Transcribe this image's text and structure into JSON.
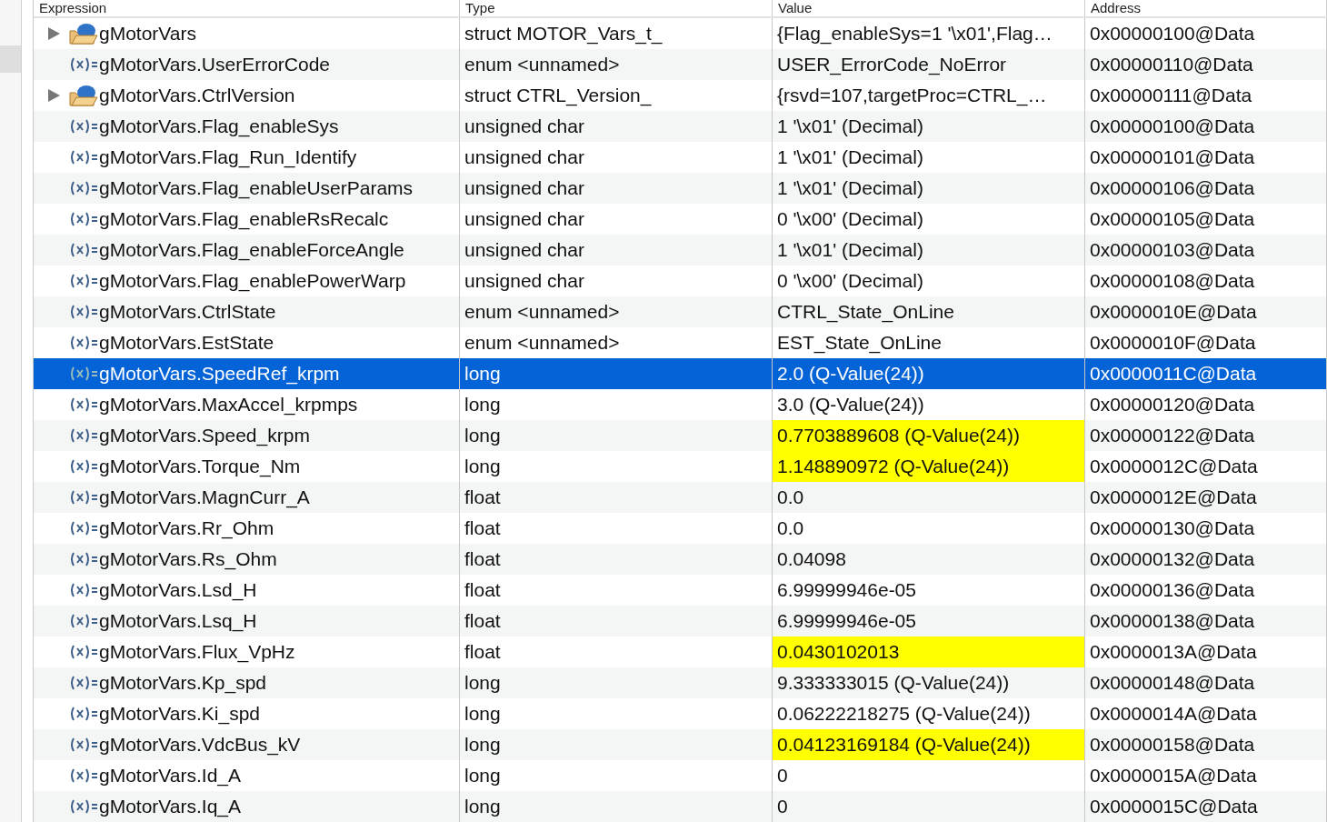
{
  "columns": [
    "Expression",
    "Type",
    "Value",
    "Address"
  ],
  "rows": [
    {
      "kind": "struct",
      "expanded": false,
      "selected": false,
      "changed": false,
      "expression": "gMotorVars",
      "type": "struct MOTOR_Vars_t_",
      "value": "{Flag_enableSys=1 '\\x01',Flag…",
      "address": "0x00000100@Data"
    },
    {
      "kind": "variable",
      "selected": false,
      "changed": false,
      "expression": "gMotorVars.UserErrorCode",
      "type": "enum <unnamed>",
      "value": "USER_ErrorCode_NoError",
      "address": "0x00000110@Data"
    },
    {
      "kind": "struct",
      "expanded": false,
      "selected": false,
      "changed": false,
      "expression": "gMotorVars.CtrlVersion",
      "type": "struct CTRL_Version_",
      "value": "{rsvd=107,targetProc=CTRL_…",
      "address": "0x00000111@Data"
    },
    {
      "kind": "variable",
      "selected": false,
      "changed": false,
      "expression": "gMotorVars.Flag_enableSys",
      "type": "unsigned char",
      "value": "1 '\\x01' (Decimal)",
      "address": "0x00000100@Data"
    },
    {
      "kind": "variable",
      "selected": false,
      "changed": false,
      "expression": "gMotorVars.Flag_Run_Identify",
      "type": "unsigned char",
      "value": "1 '\\x01' (Decimal)",
      "address": "0x00000101@Data"
    },
    {
      "kind": "variable",
      "selected": false,
      "changed": false,
      "expression": "gMotorVars.Flag_enableUserParams",
      "type": "unsigned char",
      "value": "1 '\\x01' (Decimal)",
      "address": "0x00000106@Data"
    },
    {
      "kind": "variable",
      "selected": false,
      "changed": false,
      "expression": "gMotorVars.Flag_enableRsRecalc",
      "type": "unsigned char",
      "value": "0 '\\x00' (Decimal)",
      "address": "0x00000105@Data"
    },
    {
      "kind": "variable",
      "selected": false,
      "changed": false,
      "expression": "gMotorVars.Flag_enableForceAngle",
      "type": "unsigned char",
      "value": "1 '\\x01' (Decimal)",
      "address": "0x00000103@Data"
    },
    {
      "kind": "variable",
      "selected": false,
      "changed": false,
      "expression": "gMotorVars.Flag_enablePowerWarp",
      "type": "unsigned char",
      "value": "0 '\\x00' (Decimal)",
      "address": "0x00000108@Data"
    },
    {
      "kind": "variable",
      "selected": false,
      "changed": false,
      "expression": "gMotorVars.CtrlState",
      "type": "enum <unnamed>",
      "value": "CTRL_State_OnLine",
      "address": "0x0000010E@Data"
    },
    {
      "kind": "variable",
      "selected": false,
      "changed": false,
      "expression": "gMotorVars.EstState",
      "type": "enum <unnamed>",
      "value": "EST_State_OnLine",
      "address": "0x0000010F@Data"
    },
    {
      "kind": "variable",
      "selected": true,
      "changed": false,
      "expression": "gMotorVars.SpeedRef_krpm",
      "type": "long",
      "value": "2.0 (Q-Value(24))",
      "address": "0x0000011C@Data"
    },
    {
      "kind": "variable",
      "selected": false,
      "changed": false,
      "expression": "gMotorVars.MaxAccel_krpmps",
      "type": "long",
      "value": "3.0 (Q-Value(24))",
      "address": "0x00000120@Data"
    },
    {
      "kind": "variable",
      "selected": false,
      "changed": true,
      "expression": "gMotorVars.Speed_krpm",
      "type": "long",
      "value": "0.7703889608 (Q-Value(24))",
      "address": "0x00000122@Data"
    },
    {
      "kind": "variable",
      "selected": false,
      "changed": true,
      "expression": "gMotorVars.Torque_Nm",
      "type": "long",
      "value": "1.148890972 (Q-Value(24))",
      "address": "0x0000012C@Data"
    },
    {
      "kind": "variable",
      "selected": false,
      "changed": false,
      "expression": "gMotorVars.MagnCurr_A",
      "type": "float",
      "value": "0.0",
      "address": "0x0000012E@Data"
    },
    {
      "kind": "variable",
      "selected": false,
      "changed": false,
      "expression": "gMotorVars.Rr_Ohm",
      "type": "float",
      "value": "0.0",
      "address": "0x00000130@Data"
    },
    {
      "kind": "variable",
      "selected": false,
      "changed": false,
      "expression": "gMotorVars.Rs_Ohm",
      "type": "float",
      "value": "0.04098",
      "address": "0x00000132@Data"
    },
    {
      "kind": "variable",
      "selected": false,
      "changed": false,
      "expression": "gMotorVars.Lsd_H",
      "type": "float",
      "value": "6.99999946e-05",
      "address": "0x00000136@Data"
    },
    {
      "kind": "variable",
      "selected": false,
      "changed": false,
      "expression": "gMotorVars.Lsq_H",
      "type": "float",
      "value": "6.99999946e-05",
      "address": "0x00000138@Data"
    },
    {
      "kind": "variable",
      "selected": false,
      "changed": true,
      "expression": "gMotorVars.Flux_VpHz",
      "type": "float",
      "value": "0.0430102013",
      "address": "0x0000013A@Data"
    },
    {
      "kind": "variable",
      "selected": false,
      "changed": false,
      "expression": "gMotorVars.Kp_spd",
      "type": "long",
      "value": "9.333333015 (Q-Value(24))",
      "address": "0x00000148@Data"
    },
    {
      "kind": "variable",
      "selected": false,
      "changed": false,
      "expression": "gMotorVars.Ki_spd",
      "type": "long",
      "value": "0.06222218275 (Q-Value(24))",
      "address": "0x0000014A@Data"
    },
    {
      "kind": "variable",
      "selected": false,
      "changed": true,
      "expression": "gMotorVars.VdcBus_kV",
      "type": "long",
      "value": "0.04123169184 (Q-Value(24))",
      "address": "0x00000158@Data"
    },
    {
      "kind": "variable",
      "selected": false,
      "changed": false,
      "expression": "gMotorVars.Id_A",
      "type": "long",
      "value": "0",
      "address": "0x0000015A@Data"
    },
    {
      "kind": "variable",
      "selected": false,
      "changed": false,
      "expression": "gMotorVars.Iq_A",
      "type": "long",
      "value": "0",
      "address": "0x0000015C@Data"
    }
  ]
}
